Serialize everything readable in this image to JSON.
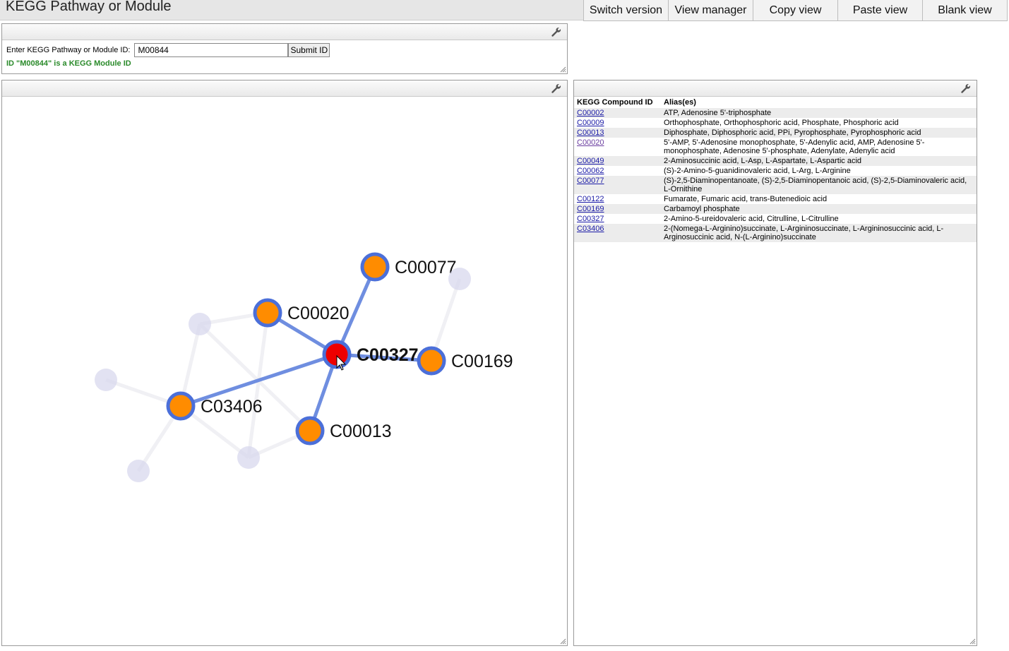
{
  "app": {
    "title": "KEGG Pathway or Module"
  },
  "toolbar": [
    "Switch version",
    "View manager",
    "Copy view",
    "Paste view",
    "Blank view"
  ],
  "id_panel": {
    "label": "Enter KEGG Pathway or Module ID:",
    "value": "M00844",
    "submit_label": "Submit ID",
    "status": "ID \"M00844\" is a KEGG Module ID"
  },
  "graph": {
    "selected": "C00327",
    "colors": {
      "selected": "#ee0000",
      "neighbor": "#ff8c00",
      "ring": "#4b6fd9",
      "edge": "#6f8ee0",
      "faded": "#d8d8ee"
    },
    "nodes": [
      {
        "id": "C00327",
        "label": "C00327",
        "state": "selected"
      },
      {
        "id": "C00077",
        "label": "C00077",
        "state": "neighbor"
      },
      {
        "id": "C00020",
        "label": "C00020",
        "state": "neighbor"
      },
      {
        "id": "C00169",
        "label": "C00169",
        "state": "neighbor"
      },
      {
        "id": "C03406",
        "label": "C03406",
        "state": "neighbor"
      },
      {
        "id": "C00013",
        "label": "C00013",
        "state": "neighbor"
      },
      {
        "id": "f1",
        "label": "",
        "state": "faded"
      },
      {
        "id": "f2",
        "label": "",
        "state": "faded"
      },
      {
        "id": "f3",
        "label": "",
        "state": "faded"
      },
      {
        "id": "f4",
        "label": "",
        "state": "faded"
      },
      {
        "id": "f5",
        "label": "",
        "state": "faded"
      }
    ],
    "edges": [
      [
        "C00327",
        "C00077"
      ],
      [
        "C00327",
        "C00020"
      ],
      [
        "C00327",
        "C00169"
      ],
      [
        "C00327",
        "C03406"
      ],
      [
        "C00327",
        "C00013"
      ]
    ],
    "faded_edges": [
      [
        "f1",
        "C00020"
      ],
      [
        "f1",
        "C03406"
      ],
      [
        "f1",
        "C00013"
      ],
      [
        "C00020",
        "f5"
      ],
      [
        "f2",
        "C03406"
      ],
      [
        "C03406",
        "f4"
      ],
      [
        "C03406",
        "f5"
      ],
      [
        "f5",
        "C00013"
      ],
      [
        "f3",
        "C00169"
      ],
      [
        "f4",
        "C03406"
      ]
    ]
  },
  "compounds": {
    "headers": [
      "KEGG Compound ID",
      "Alias(es)"
    ],
    "rows": [
      {
        "id": "C00002",
        "alias": "ATP, Adenosine 5'-triphosphate"
      },
      {
        "id": "C00009",
        "alias": "Orthophosphate, Orthophosphoric acid, Phosphate, Phosphoric acid"
      },
      {
        "id": "C00013",
        "alias": "Diphosphate, Diphosphoric acid, PPi, Pyrophosphate, Pyrophosphoric acid"
      },
      {
        "id": "C00020",
        "alias": "5'-AMP, 5'-Adenosine monophosphate, 5'-Adenylic acid, AMP, Adenosine 5'-monophosphate, Adenosine 5'-phosphate, Adenylate, Adenylic acid",
        "visited": true
      },
      {
        "id": "C00049",
        "alias": "2-Aminosuccinic acid, L-Asp, L-Aspartate, L-Aspartic acid"
      },
      {
        "id": "C00062",
        "alias": "(S)-2-Amino-5-guanidinovaleric acid, L-Arg, L-Arginine"
      },
      {
        "id": "C00077",
        "alias": "(S)-2,5-Diaminopentanoate, (S)-2,5-Diaminopentanoic acid, (S)-2,5-Diaminovaleric acid, L-Ornithine"
      },
      {
        "id": "C00122",
        "alias": "Fumarate, Fumaric acid, trans-Butenedioic acid"
      },
      {
        "id": "C00169",
        "alias": "Carbamoyl phosphate"
      },
      {
        "id": "C00327",
        "alias": "2-Amino-5-ureidovaleric acid, Citrulline, L-Citrulline"
      },
      {
        "id": "C03406",
        "alias": "2-(Nomega-L-Arginino)succinate, L-Argininosuccinate, L-Argininosuccinic acid, L-Arginosuccinic acid, N-(L-Arginino)succinate"
      }
    ]
  }
}
